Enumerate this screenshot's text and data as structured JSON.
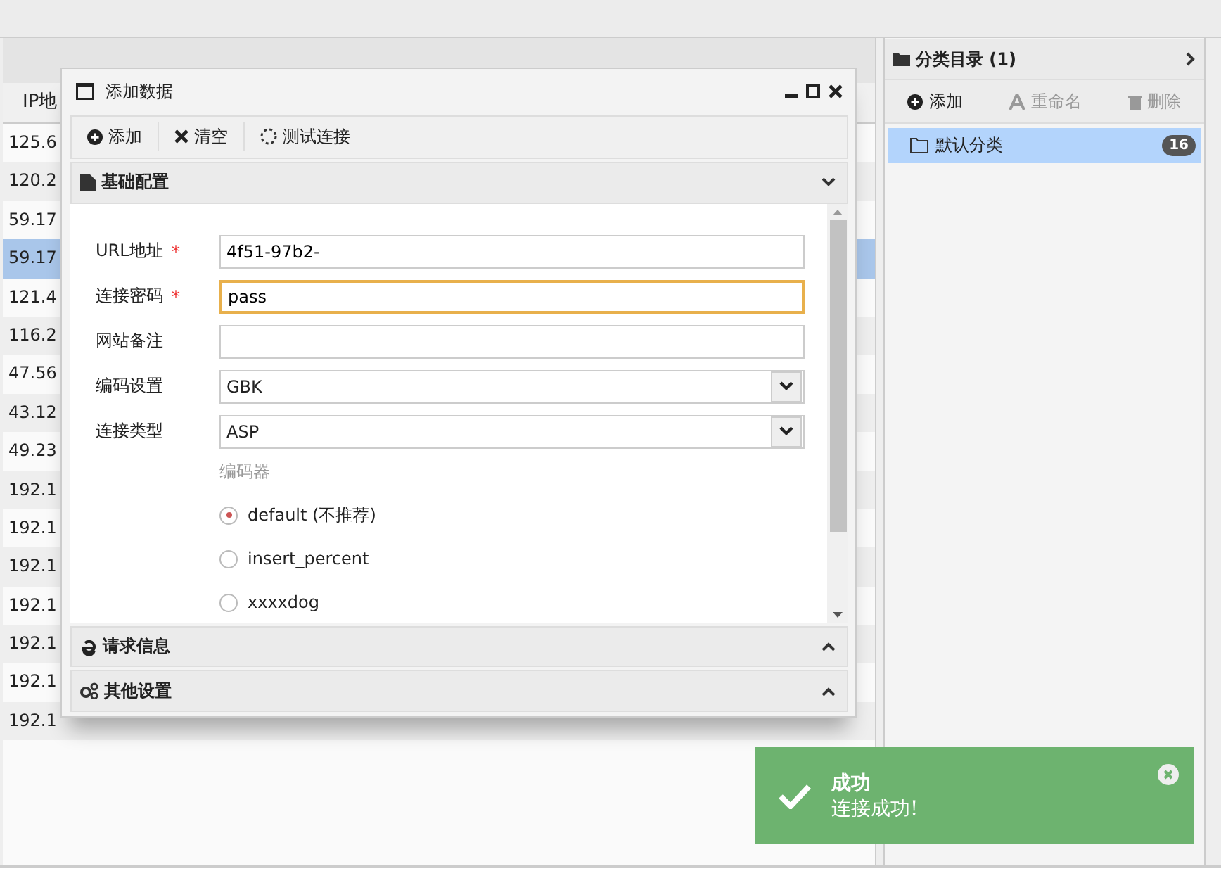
{
  "left_panel": {
    "column_header": "IP地",
    "rows": [
      {
        "ip": "125.6",
        "selected": false
      },
      {
        "ip": "120.2",
        "selected": false
      },
      {
        "ip": "59.17",
        "selected": false
      },
      {
        "ip": "59.17",
        "selected": true
      },
      {
        "ip": "121.4",
        "selected": false
      },
      {
        "ip": "116.2",
        "selected": false
      },
      {
        "ip": "47.56",
        "selected": false
      },
      {
        "ip": "43.12",
        "selected": false
      },
      {
        "ip": "49.23",
        "selected": false
      },
      {
        "ip": "192.1",
        "selected": false
      },
      {
        "ip": "192.1",
        "selected": false
      },
      {
        "ip": "192.1",
        "selected": false
      },
      {
        "ip": "192.1",
        "selected": false
      },
      {
        "ip": "192.1",
        "selected": false
      },
      {
        "ip": "192.1",
        "selected": false
      },
      {
        "ip": "192.1",
        "selected": false
      }
    ]
  },
  "category_panel": {
    "title": "分类目录 (1)",
    "toolbar": [
      {
        "label": "添加",
        "disabled": false
      },
      {
        "label": "重命名",
        "disabled": true
      },
      {
        "label": "删除",
        "disabled": true
      }
    ],
    "items": [
      {
        "label": "默认分类",
        "count": "16",
        "selected": true
      }
    ]
  },
  "dialog": {
    "title": "添加数据",
    "toolbar": [
      "添加",
      "清空",
      "测试连接"
    ],
    "sections": [
      {
        "title": "基础配置",
        "expanded": true
      },
      {
        "title": "请求信息",
        "expanded": false
      },
      {
        "title": "其他设置",
        "expanded": false
      }
    ],
    "fields": [
      {
        "kind": "text",
        "label": "URL地址",
        "marker": "*",
        "value": "4f51-97b2-",
        "focused": false
      },
      {
        "kind": "text",
        "label": "连接密码",
        "marker": "*",
        "value": "pass",
        "focused": true
      },
      {
        "kind": "text",
        "label": "网站备注",
        "focused": false
      },
      {
        "kind": "select",
        "label": "编码设置",
        "value": "GBK"
      },
      {
        "kind": "select",
        "label": "连接类型",
        "value": "ASP"
      }
    ],
    "encoder": {
      "label": "编码器",
      "options": [
        {
          "label": "default (不推荐)",
          "selected": true
        },
        {
          "label": "insert_percent",
          "selected": false
        },
        {
          "label": "xxxxdog",
          "selected": false
        }
      ]
    }
  },
  "toast": {
    "title": "成功",
    "message": "连接成功!"
  }
}
